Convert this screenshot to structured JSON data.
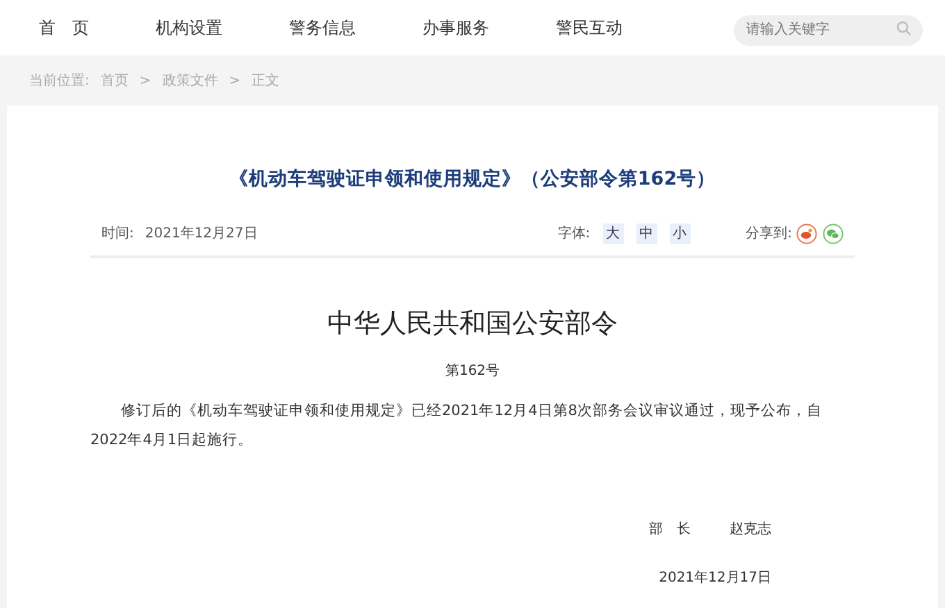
{
  "nav": {
    "items": [
      {
        "label": "首　页"
      },
      {
        "label": "机构设置"
      },
      {
        "label": "警务信息"
      },
      {
        "label": "办事服务"
      },
      {
        "label": "警民互动"
      }
    ],
    "search": {
      "placeholder": "请输入关键字"
    }
  },
  "breadcrumb": {
    "label": "当前位置:",
    "items": [
      "首页",
      "政策文件",
      "正文"
    ],
    "separator": ">"
  },
  "article": {
    "title": "《机动车驾驶证申领和使用规定》（公安部令第162号）",
    "time_label": "时间:",
    "time": "2021年12月27日",
    "font_label": "字体:",
    "font_sizes": [
      "大",
      "中",
      "小"
    ],
    "share_label": "分享到:",
    "heading": "中华人民共和国公安部令",
    "number": "第162号",
    "body": "修订后的《机动车驾驶证申领和使用规定》已经2021年12月4日第8次部务会议审议通过，现予公布，自2022年4月1日起施行。",
    "signer_title": "部　长",
    "signer_name": "赵克志",
    "date": "2021年12月17日"
  }
}
